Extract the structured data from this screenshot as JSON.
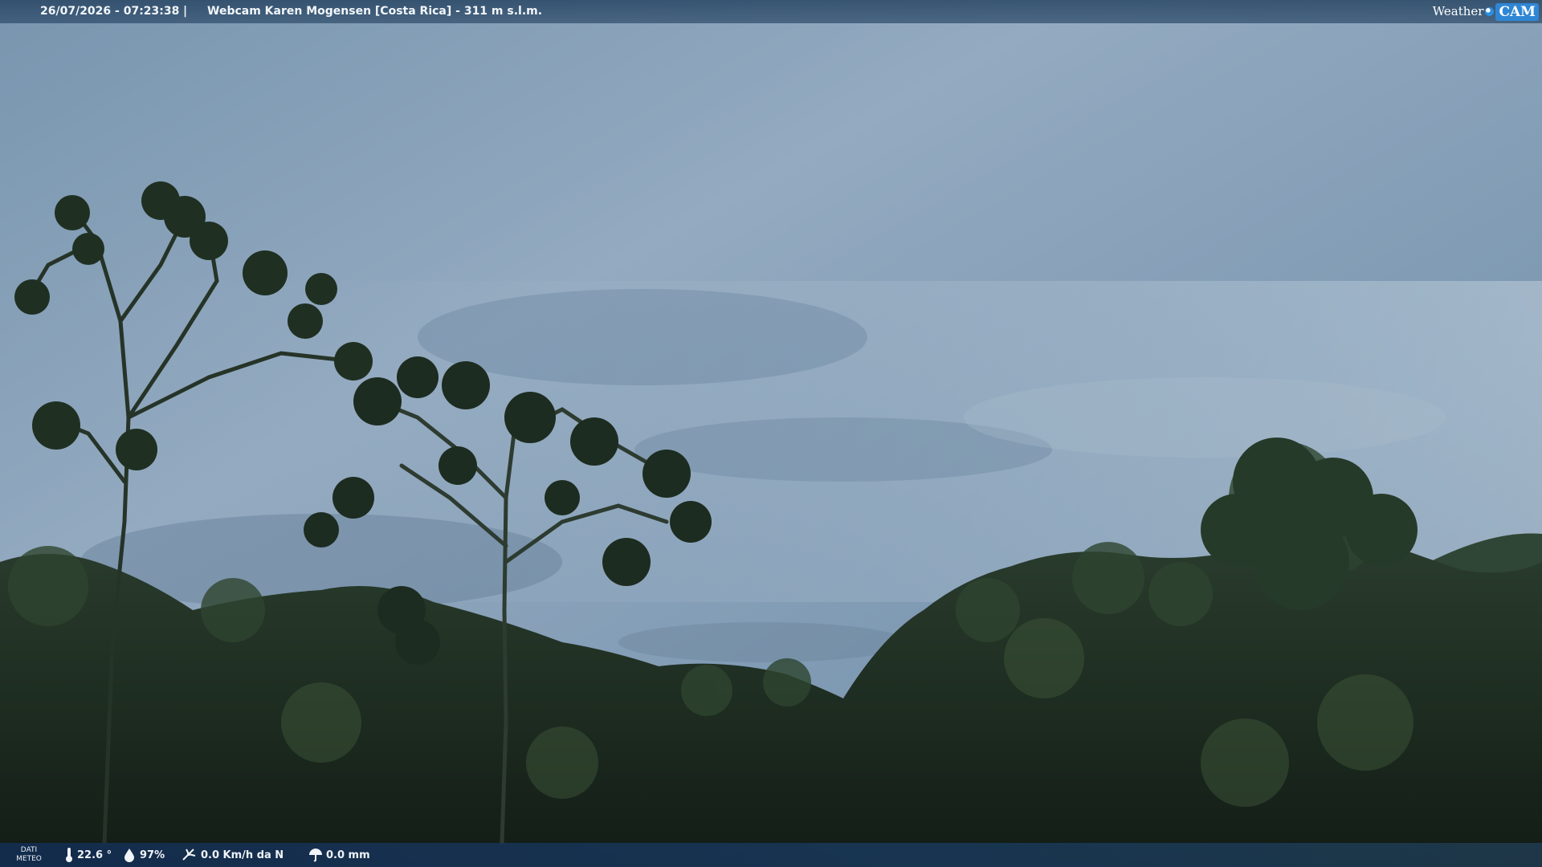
{
  "header": {
    "datetime": "26/07/2026 - 07:23:38",
    "separator": "|",
    "title": "Webcam Karen Mogensen [Costa Rica]  - 311 m s.l.m.",
    "brand_word": "Weather",
    "brand_cam": "CAM"
  },
  "footer": {
    "label_line1": "DATI",
    "label_line2": "METEO",
    "temperature": "22.6 °",
    "humidity": "97%",
    "wind": "0.0 Km/h da N",
    "rain": "0.0 mm"
  },
  "icons": {
    "temperature": "thermometer-icon",
    "humidity": "humidity-drop-icon",
    "wind": "wind-icon",
    "rain": "rain-umbrella-icon"
  },
  "colors": {
    "sky_top": "#7f9bb5",
    "sky_mid": "#93abc2",
    "sky_bottom": "#6d8aa6",
    "foliage_dark": "#14231a",
    "foliage_mid": "#2a3f2c",
    "bar": "#1f4670"
  }
}
